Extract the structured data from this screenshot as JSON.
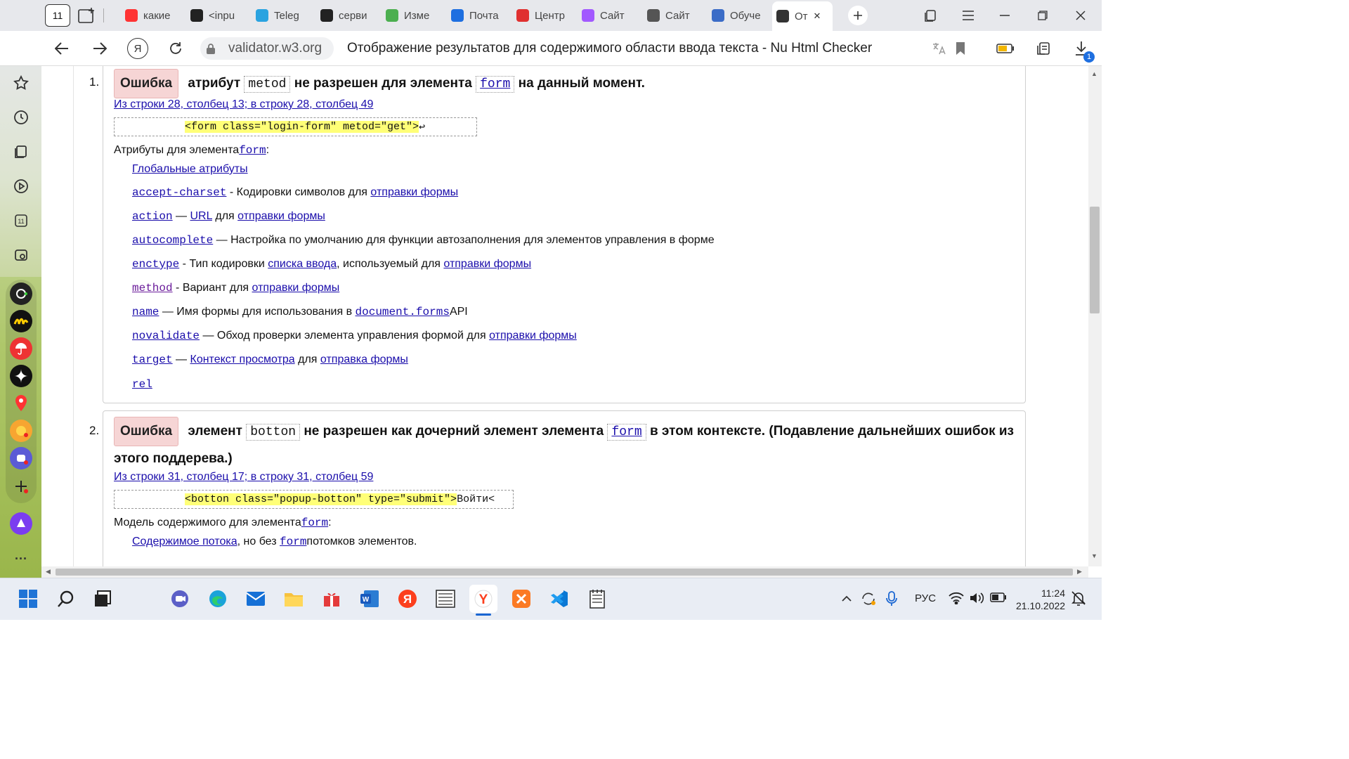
{
  "browser": {
    "tab_count": "11",
    "tabs": [
      {
        "label": "какие",
        "color": "#f33"
      },
      {
        "label": "<inpu",
        "color": "#222"
      },
      {
        "label": "Teleg",
        "color": "#2aa3e0"
      },
      {
        "label": "серви",
        "color": "#222"
      },
      {
        "label": "Изме",
        "color": "#4caf50"
      },
      {
        "label": "Почта",
        "color": "#1e6fe0"
      },
      {
        "label": "Центр",
        "color": "#e03030"
      },
      {
        "label": "Сайт",
        "color": "#a259ff"
      },
      {
        "label": "Сайт",
        "color": "#555"
      },
      {
        "label": "Обуче",
        "color": "#3b6cc7"
      },
      {
        "label": "От",
        "color": "#333"
      }
    ],
    "address": "validator.w3.org",
    "page_title": "Отображение результатов для содержимого области ввода текста - Nu Html Checker",
    "download_badge": "1"
  },
  "errors": [
    {
      "number": "1.",
      "badge": "Ошибка",
      "msg_parts": [
        "атрибут",
        "metod",
        "не разрешен для элемента",
        "form",
        "на данный момент."
      ],
      "location": "Из строки 28, столбец 13; в строку 28, столбец 49",
      "extract": "<form class=\"login-form\" metod=\"get\">",
      "extract_tail": "↩",
      "attrs_label": "Атрибуты для элемента",
      "attrs_elem": "form",
      "attrs_colon": ":",
      "global_attrs": "Глобальные атрибуты",
      "attrs": [
        {
          "name": "accept-charset",
          "sep": " - Кодировки символов для ",
          "links": [
            "отправки формы"
          ],
          "rest": ""
        },
        {
          "name": "action",
          "sep": " — ",
          "links": [
            "URL"
          ],
          "mid": " для ",
          "links2": [
            "отправки формы"
          ],
          "rest": ""
        },
        {
          "name": "autocomplete",
          "sep": " — Настройка по умолчанию для функции автозаполнения для элементов управления в форме",
          "links": [],
          "rest": ""
        },
        {
          "name": "enctype",
          "sep": " - Тип кодировки ",
          "links": [
            "списка ввода"
          ],
          "mid": ", используемый для ",
          "links2": [
            "отправки формы"
          ],
          "rest": ""
        },
        {
          "name": "method",
          "sep": " - Вариант для ",
          "links": [
            "отправки формы"
          ],
          "rest": ""
        },
        {
          "name": "name",
          "sep": " — Имя формы для использования в ",
          "monolink": "document.forms",
          "rest": "API"
        },
        {
          "name": "novalidate",
          "sep": " — Обход проверки элемента управления формой для ",
          "links": [
            "отправки формы"
          ],
          "rest": ""
        },
        {
          "name": "target",
          "sep": " — ",
          "links": [
            "Контекст просмотра"
          ],
          "mid": " для ",
          "links2": [
            "отправка формы"
          ],
          "rest": ""
        },
        {
          "name": "rel",
          "sep": "",
          "links": [],
          "rest": ""
        }
      ]
    },
    {
      "number": "2.",
      "badge": "Ошибка",
      "msg_parts": [
        "элемент",
        "botton",
        "не разрешен как дочерний элемент элемента",
        "form",
        "в этом контексте. (Подавление дальнейших ошибок из этого поддерева.)"
      ],
      "location": "Из строки 31, столбец 17; в строку 31, столбец 59",
      "extract": "<botton class=\"popup-botton\" type=\"submit\">",
      "extract_tail": "Войти<",
      "model_label": "Модель содержимого для элемента",
      "model_elem": "form",
      "model_colon": ":",
      "model_link": "Содержимое потока",
      "model_mid": ", но без ",
      "model_elem2": "form",
      "model_rest": "потомков элементов."
    }
  ],
  "taskbar": {
    "lang": "РУС",
    "time": "11:24",
    "date": "21.10.2022"
  }
}
